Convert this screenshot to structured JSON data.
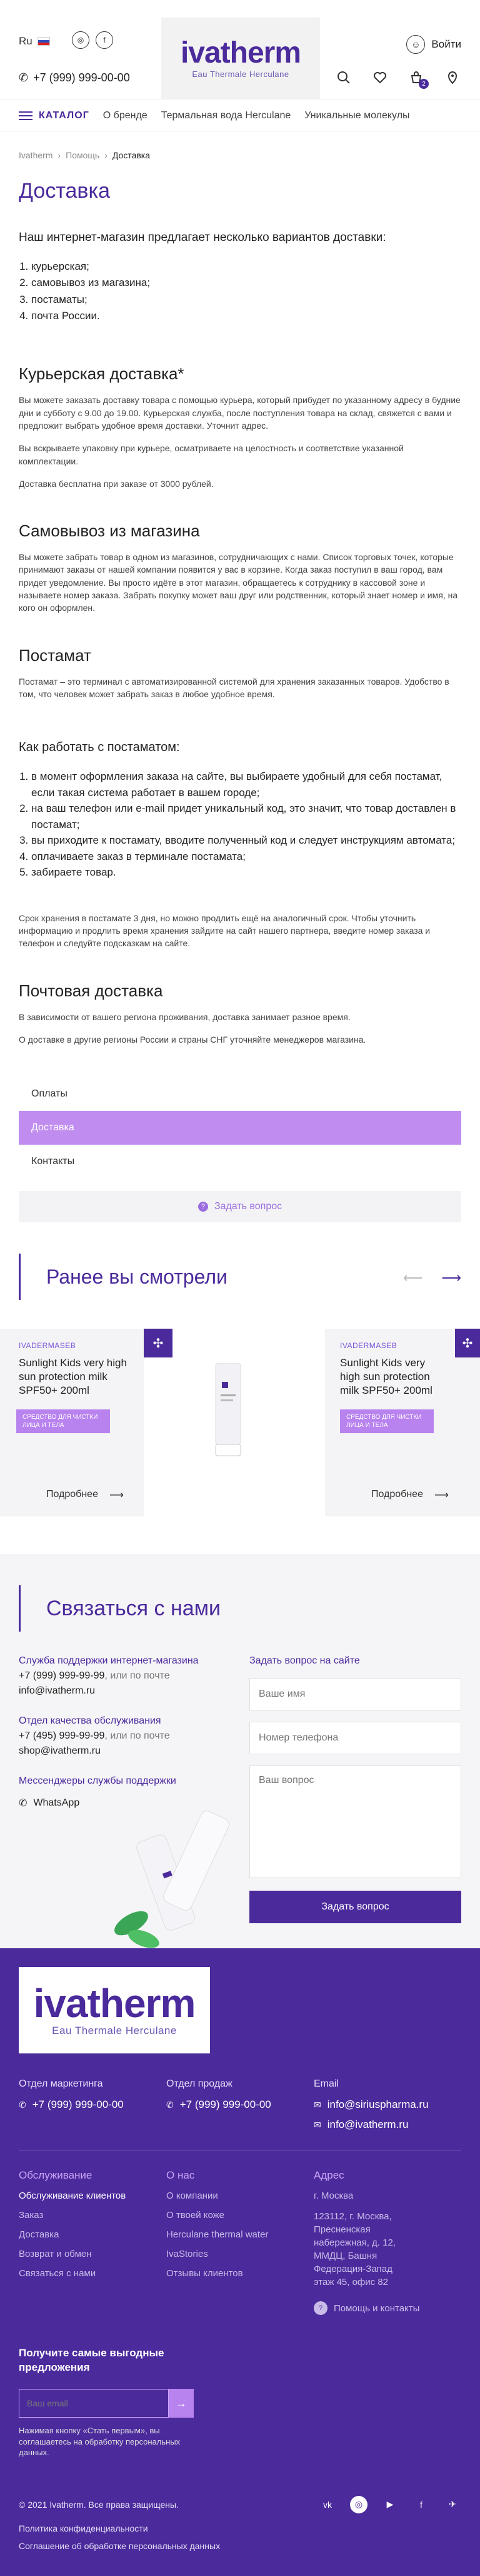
{
  "header": {
    "lang": "Ru",
    "phone": "+7 (999) 999-00-00",
    "logo_word": "ivatherm",
    "logo_sub": "Eau Thermale Herculane",
    "login": "Войти",
    "cart_count": "2"
  },
  "nav": {
    "catalog": "КАТАЛОГ",
    "items": [
      "О бренде",
      "Термальная вода Herculane",
      "Уникальные молекулы"
    ]
  },
  "breadcrumbs": [
    "Ivatherm",
    "Помощь",
    "Доставка"
  ],
  "page": {
    "title": "Доставка",
    "intro": "Наш интернет-магазин предлагает несколько вариантов доставки:",
    "methods": [
      "курьерская;",
      "самовывоз из магазина;",
      "постаматы;",
      "почта России."
    ],
    "courier": {
      "title": "Курьерская доставка*",
      "p1": "Вы можете заказать доставку товара с помощью курьера, который прибудет по указанному адресу в будние дни и субботу с 9.00 до 19.00. Курьерская служба, после поступления товара на склад, свяжется с вами и предложит выбрать удобное время доставки. Уточнит адрес.",
      "p2": "Вы вскрываете упаковку при курьере, осматриваете на целостность и соответствие указанной комплектации.",
      "p3": "Доставка бесплатна при заказе от 3000 рублей."
    },
    "pickup": {
      "title": "Самовывоз из магазина",
      "p1": "Вы можете забрать товар в одном из магазинов, сотрудничающих с нами. Список торговых точек, которые принимают заказы от нашей компании появится у вас в корзине. Когда заказ поступил в ваш город, вам придет уведомление. Вы просто идёте в этот магазин, обращаетесь к сотруднику в кассовой зоне и называете номер заказа. Забрать покупку может ваш друг или родственник, который знает номер и имя, на кого он оформлен."
    },
    "postamat": {
      "title": "Постамат",
      "p1": "Постамат – это терминал с автоматизированной системой для хранения заказанных товаров. Удобство в том, что человек может забрать заказ в любое удобное время."
    },
    "howto": {
      "title": "Как работать с постаматом:",
      "steps": [
        "в момент оформления заказа на сайте, вы выбираете удобный для себя постамат, если такая система работает в вашем городе;",
        "на ваш телефон или e-mail придет уникальный код, это значит, что товар доставлен в постамат;",
        "вы приходите к постамату, вводите полученный код и следует инструкциям автомата;",
        "оплачиваете заказ в терминале постамата;",
        "забираете товар."
      ],
      "note": "Срок хранения в постамате 3 дня, но можно продлить ещё на аналогичный срок. Чтобы уточнить информацию и продлить время хранения зайдите на сайт нашего партнера, введите номер заказа и телефон и следуйте подсказкам на сайте."
    },
    "post": {
      "title": "Почтовая доставка",
      "p1": "В зависимости от вашего региона проживания, доставка занимает разное время.",
      "p2": "О доставке в другие регионы России и страны СНГ уточняйте менеджеров магазина."
    }
  },
  "help_menu": {
    "items": [
      "Оплаты",
      "Доставка",
      "Контакты"
    ],
    "ask": "Задать вопрос"
  },
  "viewed": {
    "title": "Ранее вы смотрели",
    "cards": [
      {
        "brand": "IVADERMASEB",
        "name": "Sunlight Kids very high sun protection milk SPF50+ 200ml",
        "tag": "СРЕДСТВО ДЛЯ ЧИСТКИ ЛИЦА И ТЕЛА",
        "more": "Подробнее"
      },
      {
        "brand": "IVADERMASEB",
        "name": "Sunlight Kids very high sun protection milk SPF50+ 200ml",
        "tag": "СРЕДСТВО ДЛЯ ЧИСТКИ ЛИЦА И ТЕЛА",
        "more": "Подробнее"
      }
    ]
  },
  "contact": {
    "title": "Связаться с нами",
    "support_label": "Служба поддержки интернет-магазина",
    "support_phone": "+7 (999) 999-99-99",
    "or_mail": ", или по почте",
    "support_email": "info@ivatherm.ru",
    "quality_label": "Отдел качества обслуживания",
    "quality_phone": "+7 (495) 999-99-99",
    "quality_email": "shop@ivatherm.ru",
    "messengers_label": "Мессенджеры службы поддержки",
    "whatsapp": "WhatsApp",
    "form_label": "Задать вопрос на сайте",
    "name_ph": "Ваше имя",
    "phone_ph": "Номер телефона",
    "question_ph": "Ваш вопрос",
    "submit": "Задать вопрос"
  },
  "footer": {
    "marketing_label": "Отдел маркетинга",
    "marketing_phone": "+7 (999) 999-00-00",
    "sales_label": "Отдел продаж",
    "sales_phone": "+7 (999) 999-00-00",
    "email_label": "Email",
    "email1": "info@siriuspharma.ru",
    "email2": "info@ivatherm.ru",
    "service": {
      "title": "Обслуживание",
      "links": [
        "Обслуживание клиентов",
        "Заказ",
        "Доставка",
        "Возврат и обмен",
        "Связаться с нами"
      ]
    },
    "about": {
      "title": "О нас",
      "links": [
        "О компании",
        "О твоей коже",
        "Herculane thermal water",
        "IvaStories",
        "Отзывы клиентов"
      ]
    },
    "address": {
      "title": "Адрес",
      "lines": [
        "г. Москва",
        "123112, г. Москва, Пресненская набережная, д. 12, ММДЦ, Башня Федерация-Запад этаж 45, офис 82"
      ],
      "help": "Помощь и контакты"
    },
    "subscribe_title": "Получите самые выгодные предложения",
    "subscribe_ph": "Ваш email",
    "subscribe_note": "Нажимая кнопку «Стать первым», вы соглашаетесь на обработку персональных данных.",
    "copyright": "© 2021 Ivatherm. Все права защищены.",
    "privacy": "Политика конфиденциальности",
    "consent": "Соглашение об обработке персональных данных"
  }
}
